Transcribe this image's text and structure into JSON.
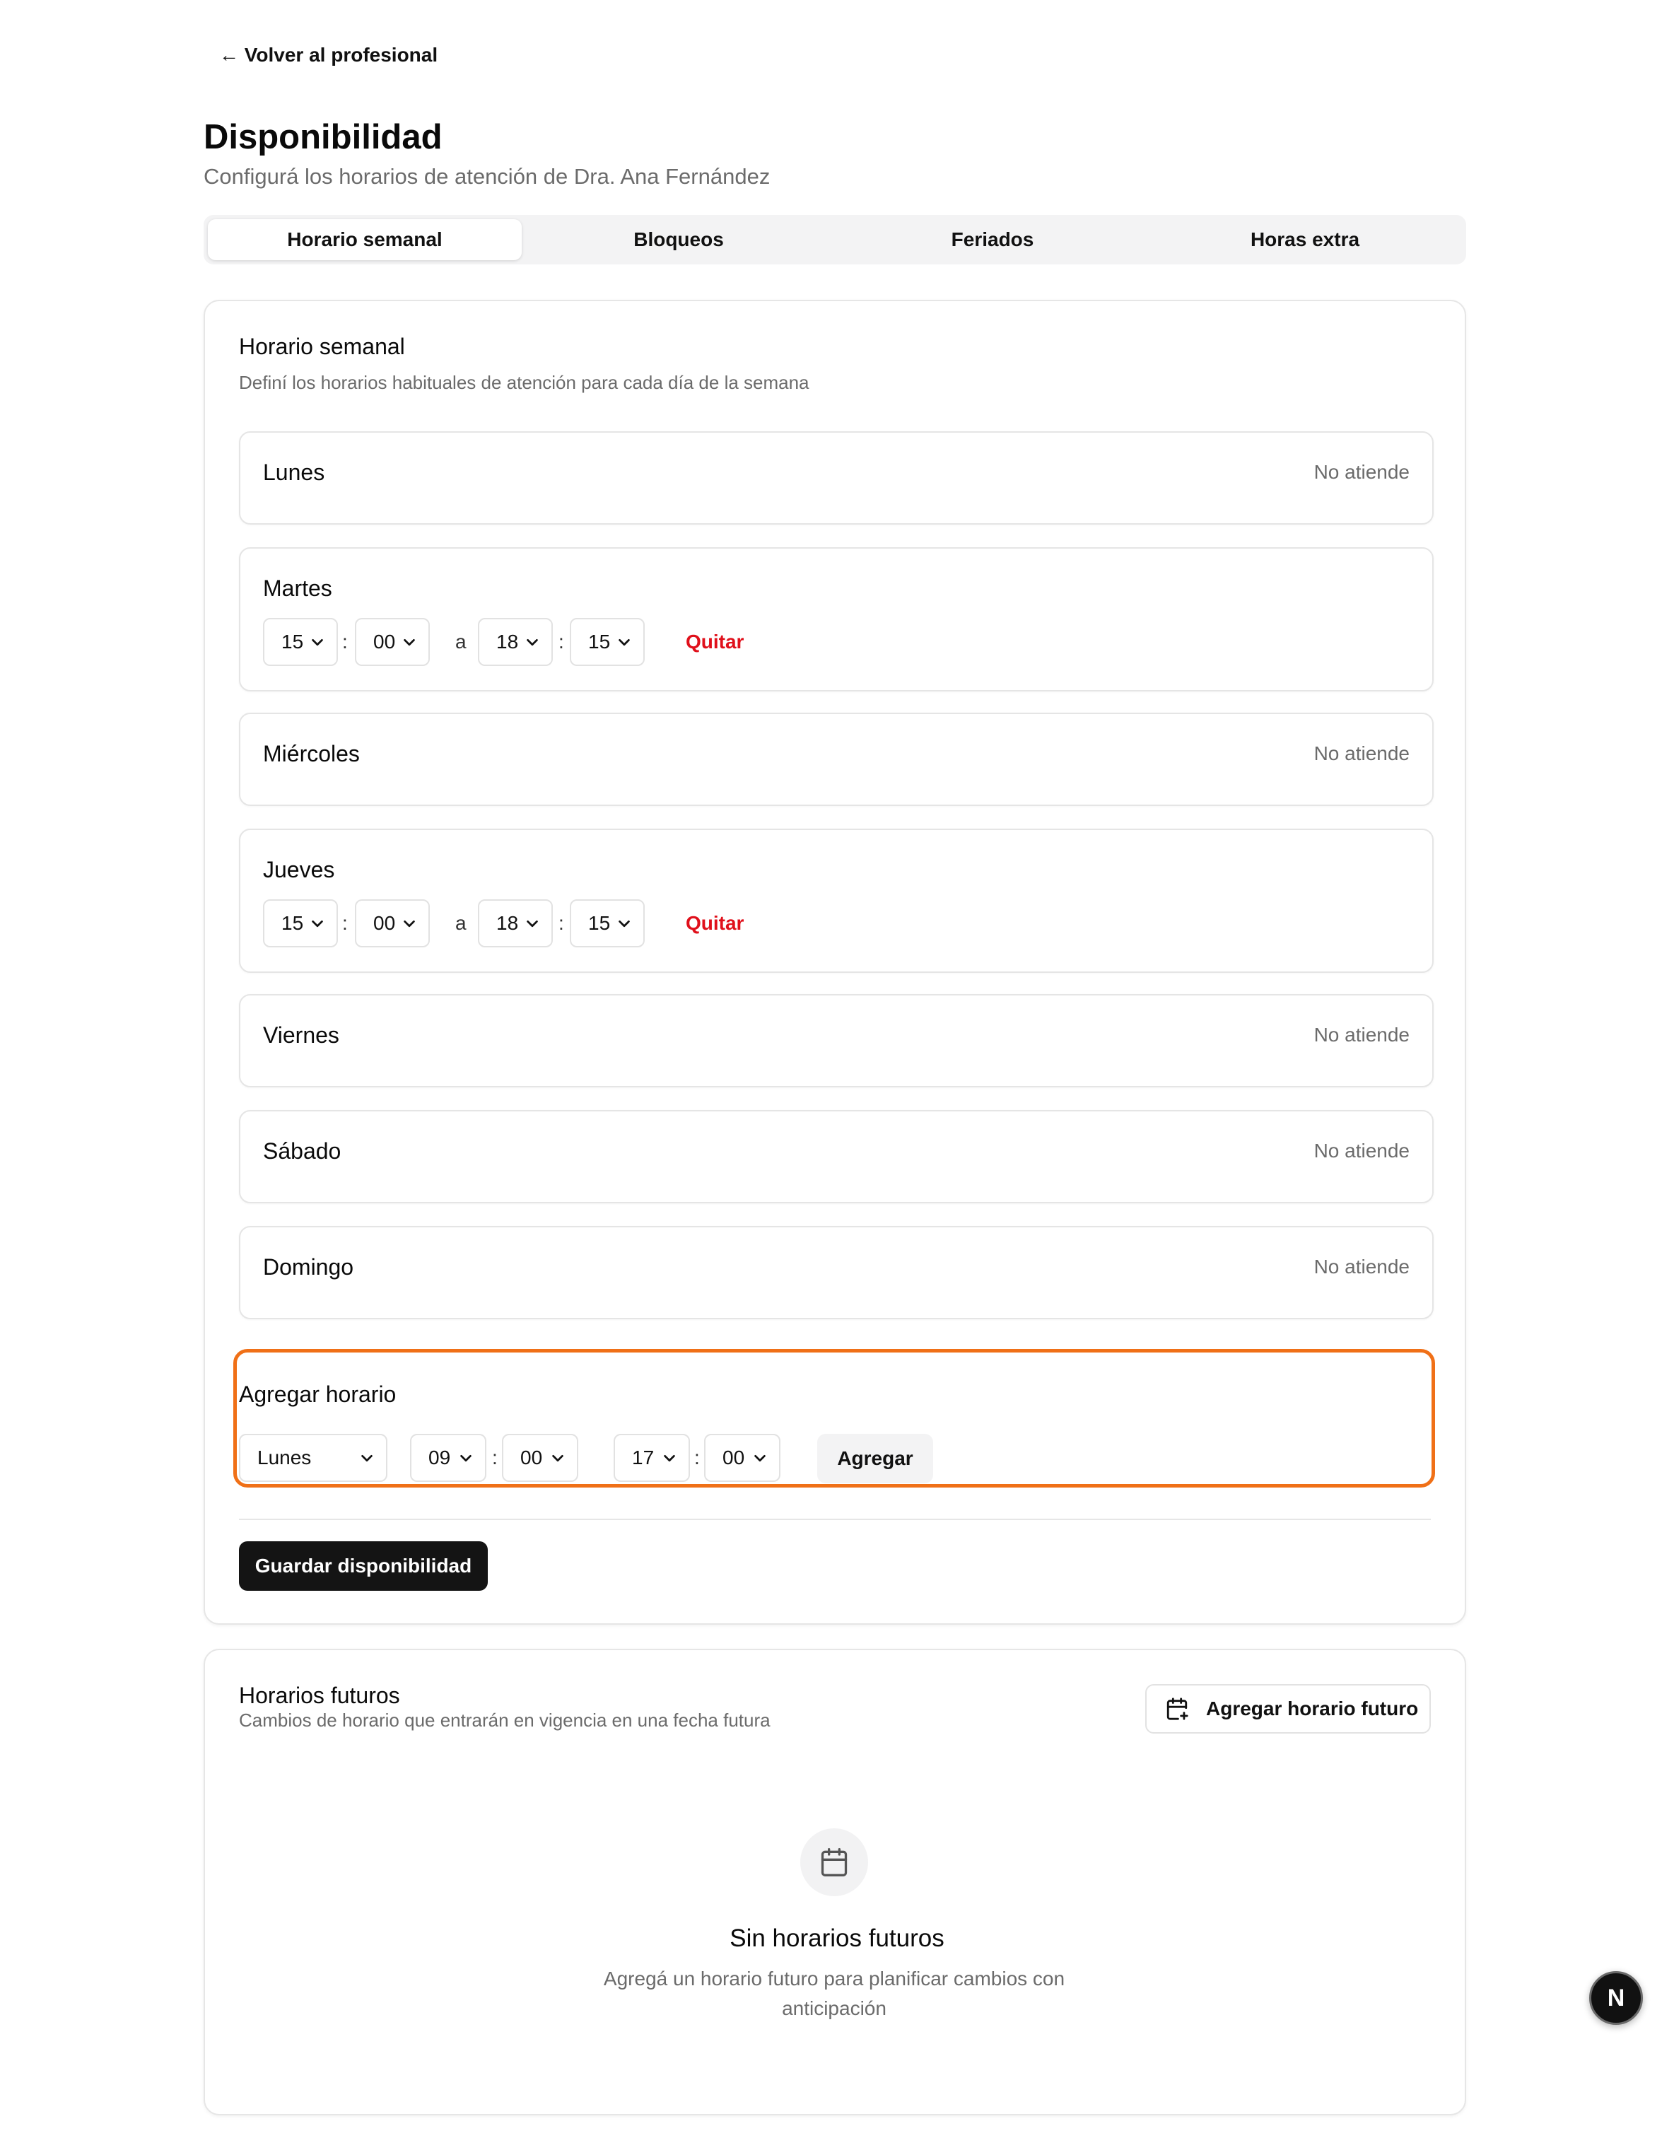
{
  "header": {
    "back_link": "← Volver al profesional",
    "title": "Disponibilidad",
    "subtitle": "Configurá los horarios de atención de Dra. Ana Fernández"
  },
  "tabs": [
    {
      "label": "Horario semanal",
      "active": true
    },
    {
      "label": "Bloqueos",
      "active": false
    },
    {
      "label": "Feriados",
      "active": false
    },
    {
      "label": "Horas extra",
      "active": false
    }
  ],
  "weekly": {
    "title": "Horario semanal",
    "description": "Definí los horarios habituales de atención para cada día de la semana",
    "no_atiende_label": "No atiende",
    "range_separator": "a",
    "time_separator": ":",
    "remove_label": "Quitar",
    "days": [
      {
        "name": "Lunes",
        "status": "No atiende"
      },
      {
        "name": "Martes",
        "start_hour": "15",
        "start_min": "00",
        "end_hour": "18",
        "end_min": "15"
      },
      {
        "name": "Miércoles",
        "status": "No atiende"
      },
      {
        "name": "Jueves",
        "start_hour": "15",
        "start_min": "00",
        "end_hour": "18",
        "end_min": "15"
      },
      {
        "name": "Viernes",
        "status": "No atiende"
      },
      {
        "name": "Sábado",
        "status": "No atiende"
      },
      {
        "name": "Domingo",
        "status": "No atiende"
      }
    ],
    "add": {
      "title": "Agregar horario",
      "day": "Lunes",
      "start_hour": "09",
      "start_min": "00",
      "end_hour": "17",
      "end_min": "00",
      "button": "Agregar"
    },
    "save_button": "Guardar disponibilidad"
  },
  "future": {
    "title": "Horarios futuros",
    "description": "Cambios de horario que entrarán en vigencia en una fecha futura",
    "add_button": "Agregar horario futuro",
    "empty_title": "Sin horarios futuros",
    "empty_desc": "Agregá un horario futuro para planificar cambios con anticipación"
  },
  "dev_badge": "N",
  "colors": {
    "accent_highlight": "#f07017",
    "danger": "#e0101b",
    "primary_button": "#141414"
  }
}
